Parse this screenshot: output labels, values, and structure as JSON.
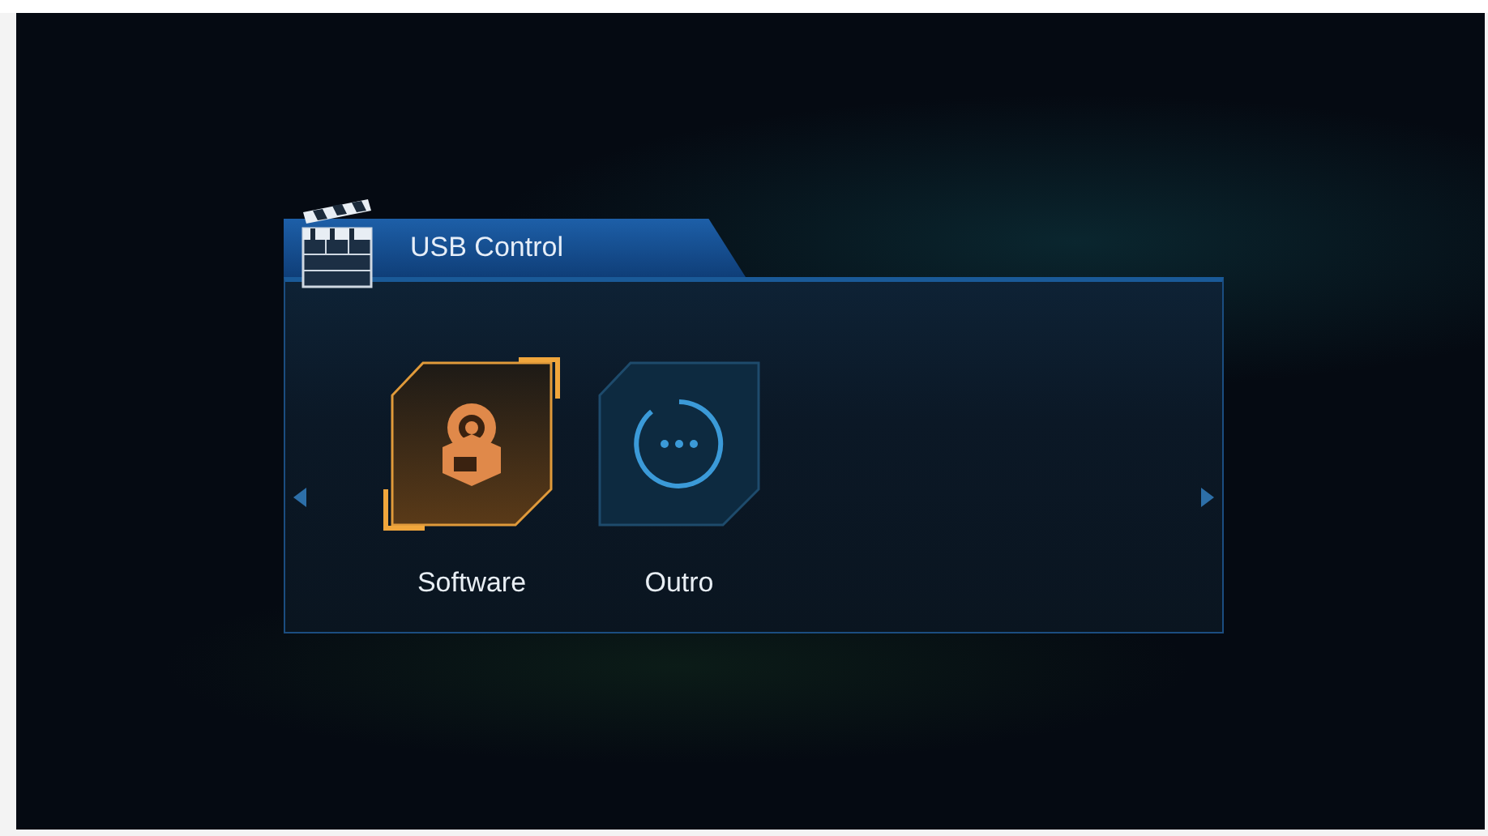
{
  "window": {
    "title": "USB Control"
  },
  "items": [
    {
      "label": "Software",
      "kind": "software",
      "selected": true
    },
    {
      "label": "Outro",
      "kind": "more",
      "selected": false
    }
  ]
}
